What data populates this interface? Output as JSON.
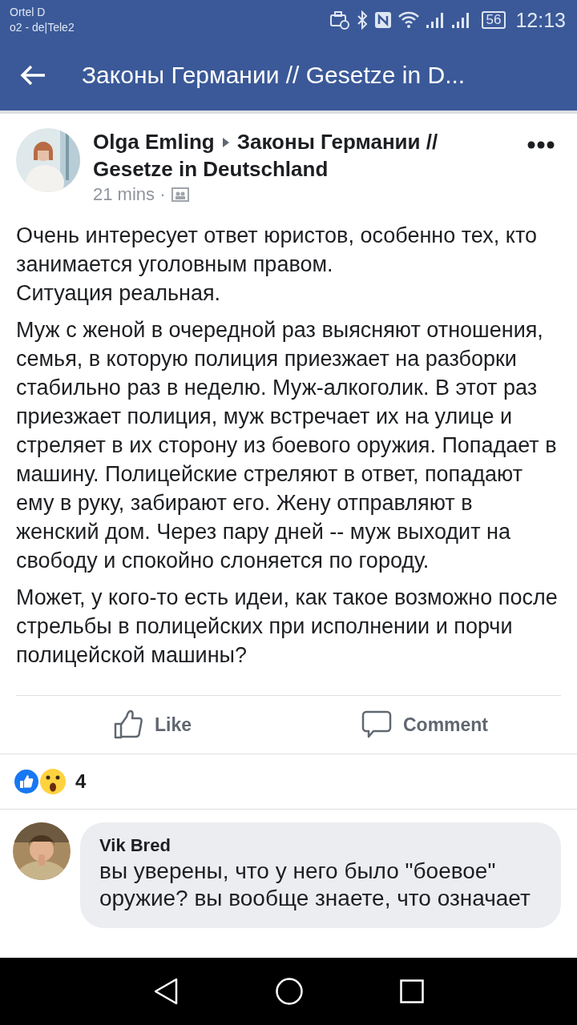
{
  "status_bar": {
    "carrier_name": "Ortel D",
    "carrier_network": "o2 - de|Tele2",
    "battery": "56",
    "time": "12:13"
  },
  "header": {
    "title": "Законы Германии // Gesetze in D..."
  },
  "post": {
    "author": "Olga Emling",
    "group_lines": [
      "Законы Германии //",
      "Gesetze in Deutschland"
    ],
    "time": "21 mins ·",
    "paragraphs": [
      "Очень интересует ответ юристов, особенно тех, кто занимается уголовным правом.\nСитуация реальная.",
      "Муж с женой в очередной раз выясняют отношения, семья, в которую полиция приезжает на разборки стабильно раз в неделю. Муж-алкоголик. В этот раз приезжает полиция, муж встречает их на улице и стреляет в их сторону из боевого оружия. Попадает в машину. Полицейские стреляют в ответ, попадают ему в руку, забирают его. Жену отправляют в женский дом. Через пару дней -- муж выходит на свободу и спокойно слоняется по городу.",
      "Может, у кого-то есть идеи, как такое возможно после стрельбы в полицейских при исполнении и порчи полицейской машины?"
    ],
    "actions": [
      {
        "kind": "like",
        "label": "Like"
      },
      {
        "kind": "comment",
        "label": "Comment"
      }
    ],
    "reactions": {
      "count": "4"
    }
  },
  "comments": [
    {
      "author": "Vik Bred",
      "text": "вы уверены, что у него было \"боевое\" оружие? вы вообще знаете, что означает"
    }
  ]
}
